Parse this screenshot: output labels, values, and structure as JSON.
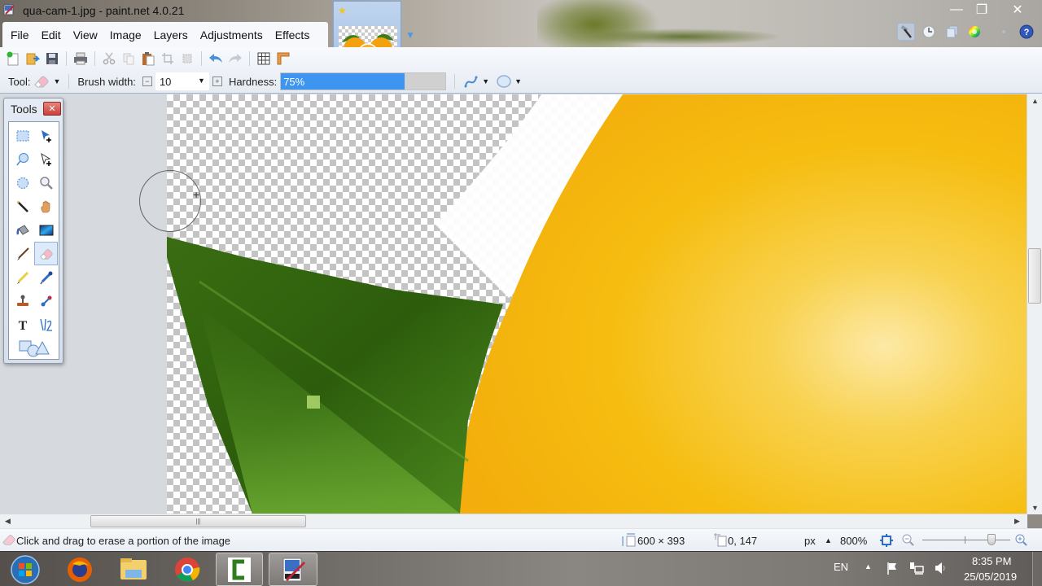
{
  "window": {
    "title": "qua-cam-1.jpg - paint.net 4.0.21",
    "controls": {
      "minimize": "—",
      "restore": "❐",
      "close": "✕"
    }
  },
  "menu": [
    "File",
    "Edit",
    "View",
    "Image",
    "Layers",
    "Adjustments",
    "Effects"
  ],
  "image_tab": {
    "name": "qua-cam-1.jpg",
    "unsaved_marker": "★"
  },
  "toolbar": {
    "tool_label": "Tool:",
    "brush_width_label": "Brush width:",
    "brush_width_value": "10",
    "hardness_label": "Hardness:",
    "hardness_value": "75%",
    "hardness_fraction": 0.75
  },
  "tools_window": {
    "title": "Tools",
    "close": "✕",
    "tools": [
      "rectangle-select",
      "move-selected-pixels",
      "lasso-select",
      "move-selection",
      "ellipse-select",
      "zoom",
      "magic-wand",
      "pan",
      "paint-bucket",
      "gradient",
      "paintbrush",
      "eraser",
      "pencil",
      "color-picker",
      "clone-stamp",
      "recolor",
      "text",
      "line-curve",
      "shapes"
    ],
    "active_tool": "eraser"
  },
  "statusbar": {
    "message": "Click and drag to erase a portion of the image",
    "image_size": "600 × 393",
    "cursor_position": "0, 147",
    "units": "px",
    "zoom": "800%"
  },
  "taskbar": {
    "apps": [
      "start",
      "firefox",
      "file-explorer",
      "chrome",
      "camtasia",
      "paint.net"
    ],
    "language": "EN",
    "time": "8:35 PM",
    "date": "25/05/2019"
  },
  "colors": {
    "accent": "#3d95f0",
    "leaf_dark": "#2f5a0f",
    "leaf_light": "#5f9a2a",
    "orange": "#f5b80f"
  }
}
